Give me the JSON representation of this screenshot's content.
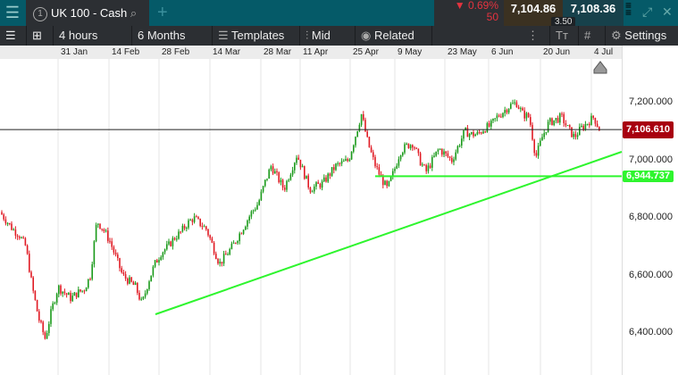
{
  "header": {
    "menu_icon": "hamburger-icon",
    "tab_number": "1",
    "instrument": "UK 100 - Cash",
    "change_pct": "0.69%",
    "change_pts": "50",
    "sell": "7,104.86",
    "buy": "7,108.36",
    "spread": "3.50"
  },
  "toolbar": {
    "interval": "4 hours",
    "range": "6 Months",
    "templates": "Templates",
    "price_type": "Mid",
    "related": "Related",
    "settings": "Settings"
  },
  "colors": {
    "up": "#1a9a1a",
    "down": "#e01b24",
    "trend": "#2ef52e",
    "last_price": "#a8000f"
  },
  "chart_data": {
    "type": "candlestick",
    "x_ticks": [
      "31 Jan",
      "14 Feb",
      "28 Feb",
      "14 Mar",
      "28 Mar",
      "11 Apr",
      "25 Apr",
      "9 May",
      "23 May",
      "6 Jun",
      "20 Jun",
      "4 Jul"
    ],
    "y_ticks": [
      "7,200.000",
      "7,000.000",
      "6,800.000",
      "6,600.000",
      "6,400.000"
    ],
    "y_tick_values": [
      7200,
      7000,
      6800,
      6600,
      6400
    ],
    "last_price_label": "7,106.610",
    "last_price": 7106.61,
    "horizontal_line_label": "6,944.737",
    "horizontal_line": 6944.737,
    "trendline": [
      [
        6460,
        "28 Feb"
      ],
      [
        7020,
        "after 4 Jul"
      ]
    ],
    "close_path": [
      6820,
      6790,
      6760,
      6740,
      6700,
      6560,
      6450,
      6380,
      6480,
      6560,
      6540,
      6520,
      6540,
      6550,
      6600,
      6790,
      6760,
      6720,
      6660,
      6600,
      6580,
      6560,
      6500,
      6580,
      6640,
      6680,
      6700,
      6730,
      6750,
      6780,
      6800,
      6780,
      6760,
      6700,
      6640,
      6670,
      6700,
      6740,
      6780,
      6820,
      6850,
      6920,
      6980,
      6940,
      6900,
      6960,
      7020,
      6960,
      6900,
      6910,
      6920,
      6950,
      6980,
      6990,
      7000,
      7080,
      7160,
      7060,
      6990,
      6940,
      6900,
      6960,
      7030,
      7050,
      7060,
      7000,
      6960,
      7000,
      7040,
      7020,
      7000,
      7050,
      7100,
      7090,
      7090,
      7110,
      7120,
      7150,
      7170,
      7190,
      7200,
      7160,
      7150,
      7010,
      7080,
      7130,
      7140,
      7150,
      7110,
      7080,
      7110,
      7130,
      7150,
      7100
    ]
  }
}
